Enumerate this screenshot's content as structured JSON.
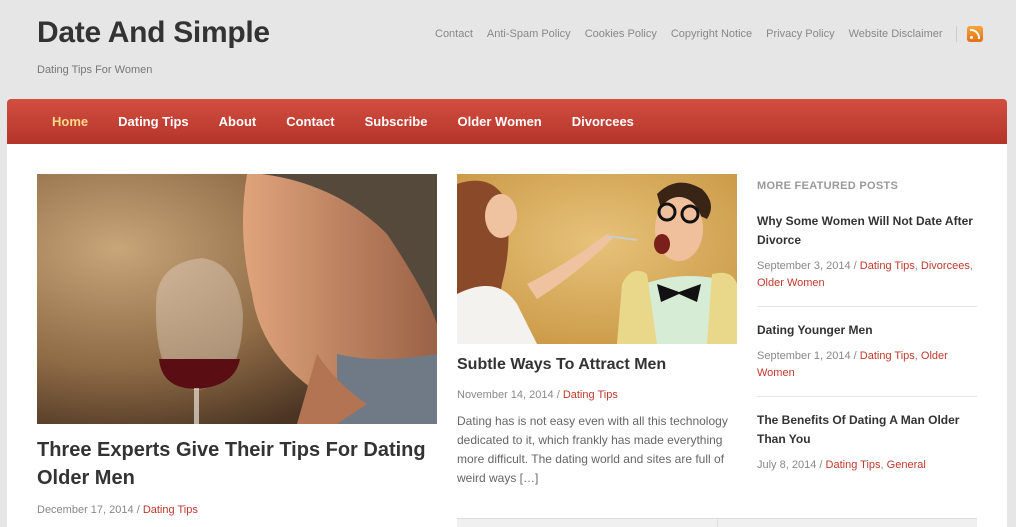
{
  "header": {
    "title": "Date And Simple",
    "tagline": "Dating Tips For Women",
    "links": [
      "Contact",
      "Anti-Spam Policy",
      "Cookies Policy",
      "Copyright Notice",
      "Privacy Policy",
      "Website Disclaimer"
    ],
    "rss_icon": "rss-icon"
  },
  "nav": {
    "items": [
      "Home",
      "Dating Tips",
      "About",
      "Contact",
      "Subscribe",
      "Older Women",
      "Divorcees"
    ],
    "active": "Home"
  },
  "featured": {
    "title": "Three Experts Give Their Tips For Dating Older Men",
    "date": "December 17, 2014",
    "sep": "/",
    "category": "Dating Tips"
  },
  "secondary": {
    "title": "Subtle Ways To Attract Men",
    "date": "November 14, 2014",
    "sep": "/",
    "category": "Dating Tips",
    "excerpt": "Dating has is not easy even with all this technology dedicated to it, which frankly has made everything more difficult. The dating world and sites are full of weird ways […]"
  },
  "sidebar": {
    "heading": "MORE FEATURED POSTS",
    "posts": [
      {
        "title": "Why Some Women Will Not Date After Divorce",
        "date": "September 3, 2014",
        "sep": "/",
        "cats": [
          "Dating Tips",
          "Divorcees",
          "Older Women"
        ]
      },
      {
        "title": "Dating Younger Men",
        "date": "September 1, 2014",
        "sep": "/",
        "cats": [
          "Dating Tips",
          "Older Women"
        ]
      },
      {
        "title": "The Benefits Of Dating A Man Older Than You",
        "date": "July 8, 2014",
        "sep": "/",
        "cats": [
          "Dating Tips",
          "General"
        ]
      }
    ]
  },
  "colors": {
    "accent": "#c0392b",
    "nav_active": "#ffd88a",
    "nav_bg": "#c4443a"
  }
}
